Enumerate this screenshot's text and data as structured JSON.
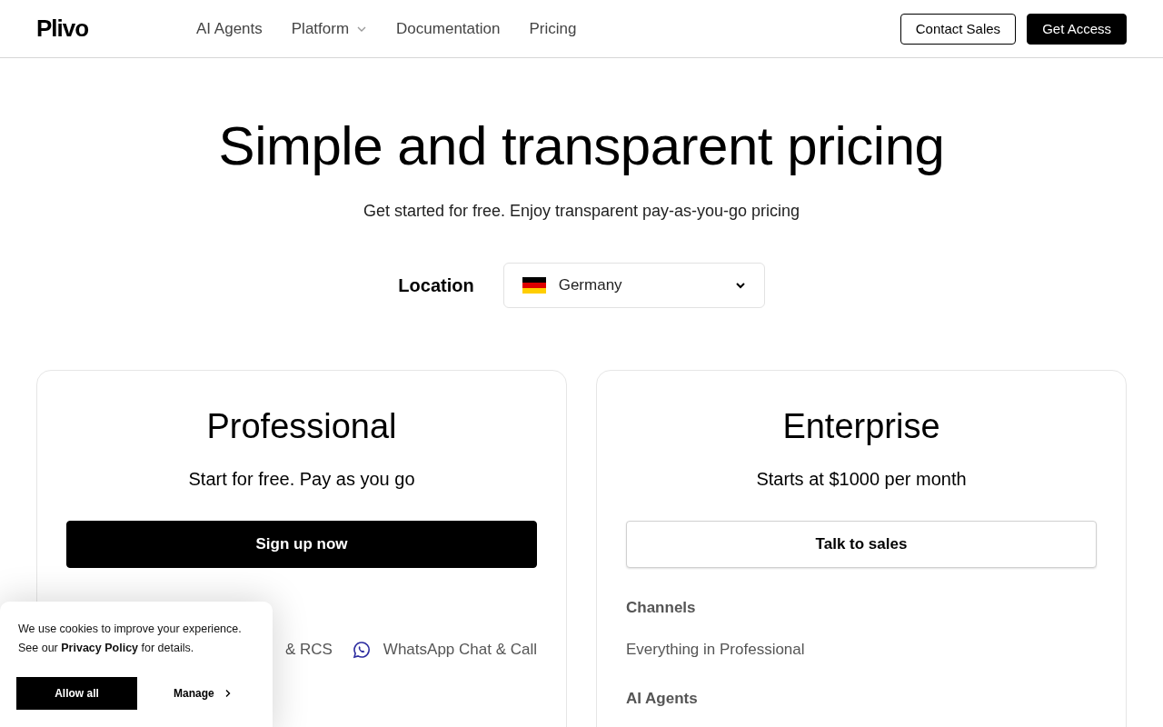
{
  "header": {
    "logo": "Plivo",
    "nav": [
      {
        "label": "AI Agents",
        "dropdown": false
      },
      {
        "label": "Platform",
        "dropdown": true
      },
      {
        "label": "Documentation",
        "dropdown": false
      },
      {
        "label": "Pricing",
        "dropdown": false
      }
    ],
    "buttons": [
      {
        "label": "Contact Sales",
        "kind": "outline"
      },
      {
        "label": "Get Access",
        "kind": "solid"
      }
    ]
  },
  "hero": {
    "title": "Simple and transparent pricing",
    "subtitle": "Get started for free. Enjoy transparent pay-as-you-go pricing"
  },
  "location": {
    "label": "Location",
    "value": "Germany"
  },
  "plans": [
    {
      "name": "Professional",
      "tagline": "Start for free. Pay as you go",
      "button": {
        "label": "Sign up now",
        "kind": "solid"
      },
      "sections": [
        {
          "features": [
            {
              "label": "& RCS",
              "kind": "plain"
            },
            {
              "label": "WhatsApp Chat & Call",
              "kind": "whatsapp"
            }
          ]
        }
      ]
    },
    {
      "name": "Enterprise",
      "tagline": "Starts at $1000 per month",
      "button": {
        "label": "Talk to sales",
        "kind": "outline"
      },
      "sections": [
        {
          "heading": "Channels",
          "features": [
            {
              "label": "Everything in Professional",
              "kind": "plain"
            }
          ]
        },
        {
          "heading": "AI Agents"
        }
      ]
    }
  ],
  "cookie_banner": {
    "text": "We use cookies to improve your experience. See our **Privacy Policy** for details.",
    "allow": "Allow all",
    "manage": "Manage"
  }
}
